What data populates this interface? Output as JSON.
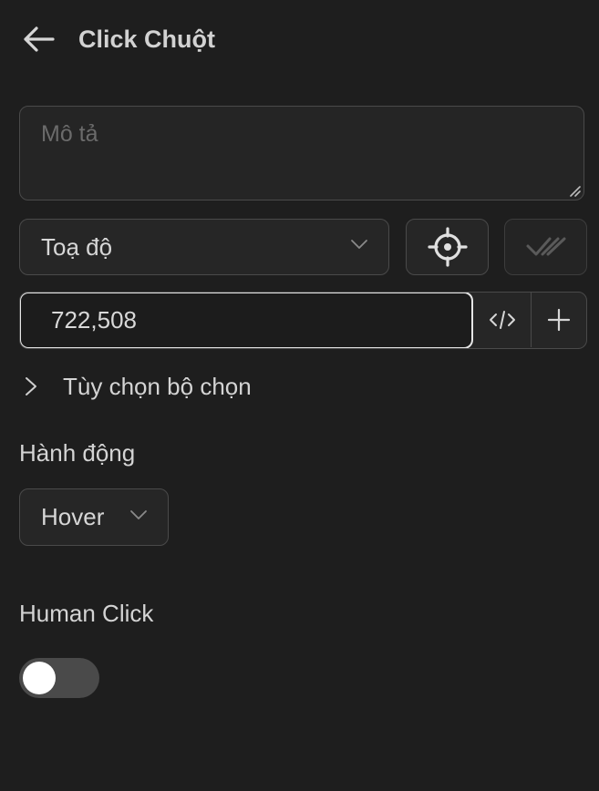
{
  "header": {
    "title": "Click Chuột",
    "back_icon": "arrow-left-icon"
  },
  "description": {
    "placeholder": "Mô tả",
    "value": ""
  },
  "selector": {
    "type_selected": "Toạ độ",
    "target_icon": "crosshair-icon",
    "verify_icon": "double-check-icon",
    "value": "722,508",
    "code_icon": "code-icon",
    "add_icon": "plus-icon"
  },
  "selector_options": {
    "label": "Tùy chọn bộ chọn",
    "expanded": false
  },
  "action": {
    "label": "Hành động",
    "selected": "Hover"
  },
  "human_click": {
    "label": "Human Click",
    "enabled": false
  },
  "colors": {
    "background": "#1e1e1e",
    "border": "#4a4a4a",
    "text": "#d4d4d4",
    "placeholder": "#6b6b6b",
    "toggle_track": "#4a4a4a",
    "toggle_knob": "#ffffff"
  }
}
